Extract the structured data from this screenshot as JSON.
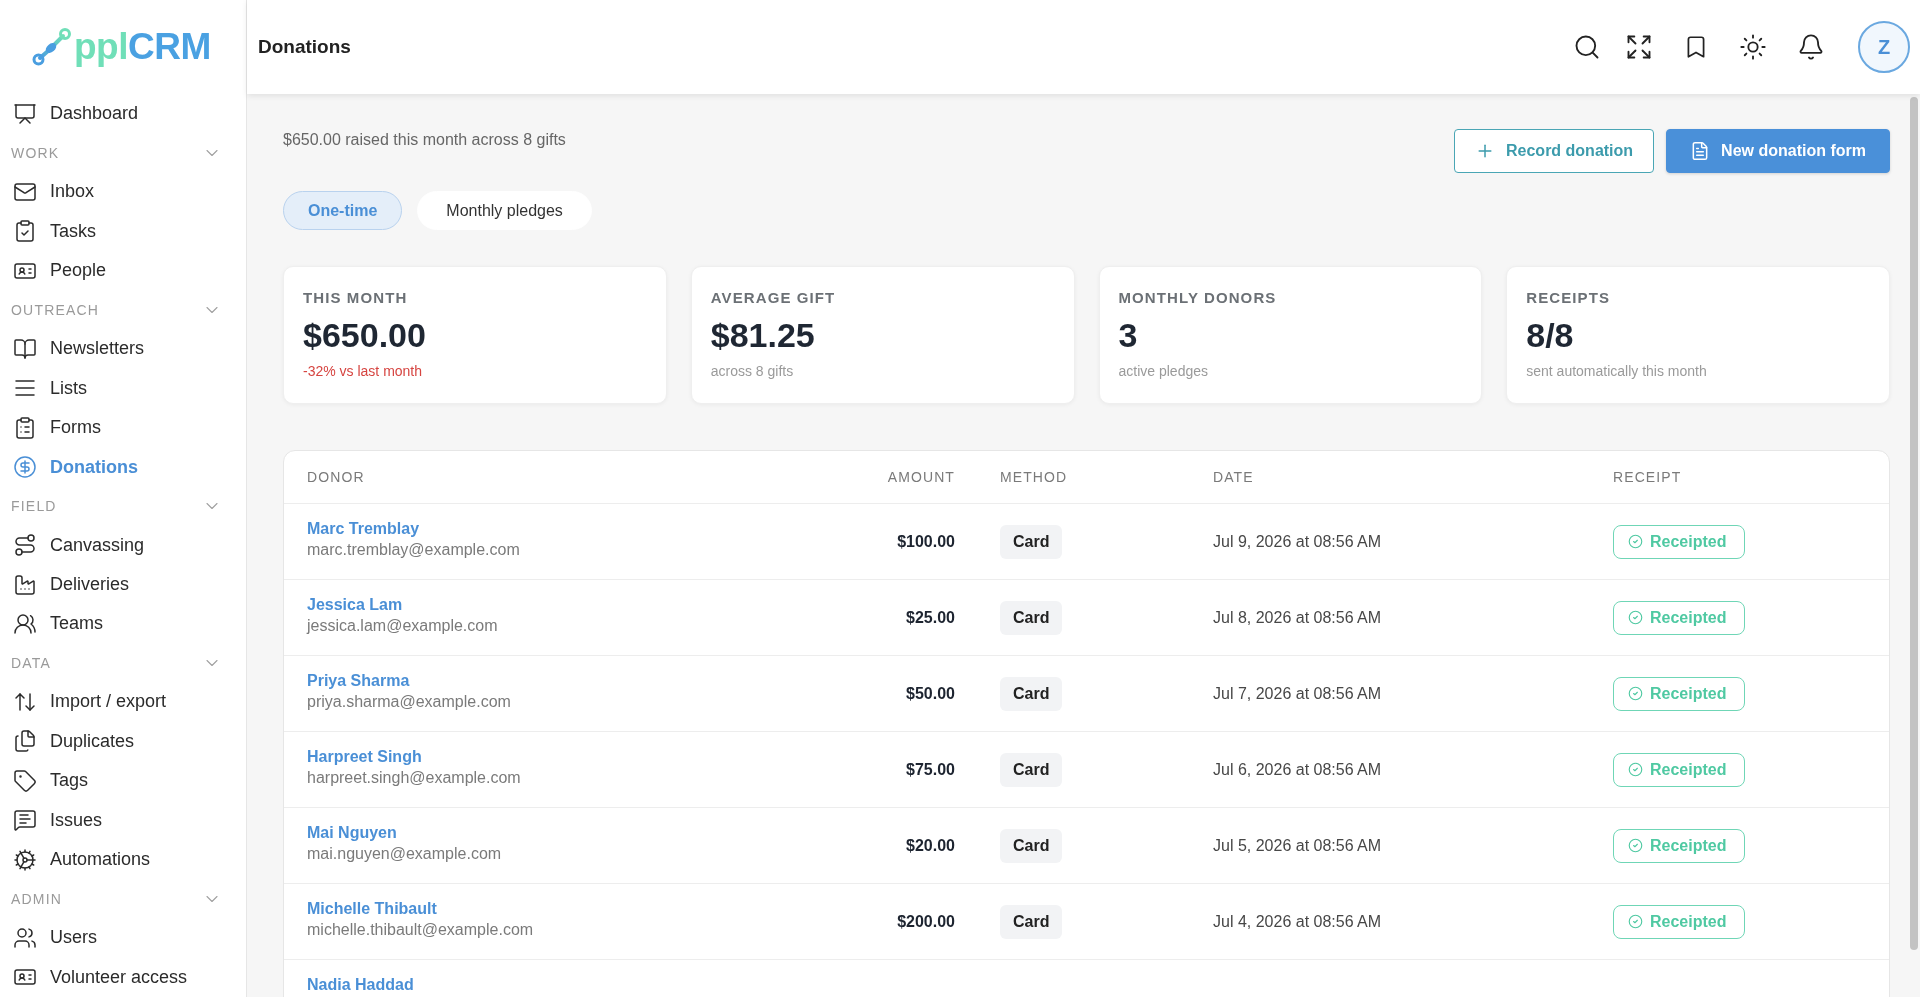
{
  "sidebar": {
    "logo": {
      "text": "ppl",
      "accent": "CRM"
    },
    "top_items": [
      {
        "label": "Dashboard",
        "selected": false
      }
    ],
    "sections": [
      {
        "label": "WORK",
        "expanded": true,
        "items": [
          {
            "label": "Inbox",
            "selected": false
          },
          {
            "label": "Tasks",
            "selected": false
          },
          {
            "label": "People",
            "selected": false
          }
        ]
      },
      {
        "label": "OUTREACH",
        "expanded": true,
        "items": [
          {
            "label": "Newsletters",
            "selected": false
          },
          {
            "label": "Lists",
            "selected": false
          },
          {
            "label": "Forms",
            "selected": false
          },
          {
            "label": "Donations",
            "selected": true
          }
        ]
      },
      {
        "label": "FIELD",
        "expanded": true,
        "items": [
          {
            "label": "Canvassing",
            "selected": false
          },
          {
            "label": "Deliveries",
            "selected": false
          },
          {
            "label": "Teams",
            "selected": false
          }
        ]
      },
      {
        "label": "DATA",
        "expanded": true,
        "items": [
          {
            "label": "Import / export",
            "selected": false
          },
          {
            "label": "Duplicates",
            "selected": false
          },
          {
            "label": "Tags",
            "selected": false
          },
          {
            "label": "Issues",
            "selected": false
          },
          {
            "label": "Automations",
            "selected": false
          }
        ]
      },
      {
        "label": "ADMIN",
        "expanded": true,
        "items": [
          {
            "label": "Users",
            "selected": false
          },
          {
            "label": "Volunteer access",
            "selected": false
          }
        ]
      }
    ]
  },
  "header": {
    "title": "Donations",
    "avatar": "Z"
  },
  "summary": "$650.00 raised this month across 8 gifts",
  "actions": [
    {
      "label": "Record donation",
      "kind": "outline"
    },
    {
      "label": "New donation form",
      "kind": "primary"
    }
  ],
  "tabs": [
    {
      "label": "One-time",
      "selected": true
    },
    {
      "label": "Monthly pledges",
      "selected": false
    }
  ],
  "stats": [
    {
      "label": "THIS MONTH",
      "value": "$650.00",
      "note": "-32% vs last month",
      "negative": true
    },
    {
      "label": "AVERAGE GIFT",
      "value": "$81.25",
      "note": "across 8 gifts",
      "negative": false
    },
    {
      "label": "MONTHLY DONORS",
      "value": "3",
      "note": "active pledges",
      "negative": false
    },
    {
      "label": "RECEIPTS",
      "value": "8/8",
      "note": "sent automatically this month",
      "negative": false
    }
  ],
  "table": {
    "columns": [
      "DONOR",
      "AMOUNT",
      "METHOD",
      "DATE",
      "RECEIPT"
    ],
    "rows": [
      {
        "donor": "Marc Tremblay",
        "email": "marc.tremblay@example.com",
        "amount": "$100.00",
        "method": "Card",
        "date": "Jul 9, 2026 at 08:56 AM",
        "receipt": "Receipted"
      },
      {
        "donor": "Jessica Lam",
        "email": "jessica.lam@example.com",
        "amount": "$25.00",
        "method": "Card",
        "date": "Jul 8, 2026 at 08:56 AM",
        "receipt": "Receipted"
      },
      {
        "donor": "Priya Sharma",
        "email": "priya.sharma@example.com",
        "amount": "$50.00",
        "method": "Card",
        "date": "Jul 7, 2026 at 08:56 AM",
        "receipt": "Receipted"
      },
      {
        "donor": "Harpreet Singh",
        "email": "harpreet.singh@example.com",
        "amount": "$75.00",
        "method": "Card",
        "date": "Jul 6, 2026 at 08:56 AM",
        "receipt": "Receipted"
      },
      {
        "donor": "Mai Nguyen",
        "email": "mai.nguyen@example.com",
        "amount": "$20.00",
        "method": "Card",
        "date": "Jul 5, 2026 at 08:56 AM",
        "receipt": "Receipted"
      },
      {
        "donor": "Michelle Thibault",
        "email": "michelle.thibault@example.com",
        "amount": "$200.00",
        "method": "Card",
        "date": "Jul 4, 2026 at 08:56 AM",
        "receipt": "Receipted"
      },
      {
        "donor": "Nadia Haddad"
      }
    ]
  }
}
